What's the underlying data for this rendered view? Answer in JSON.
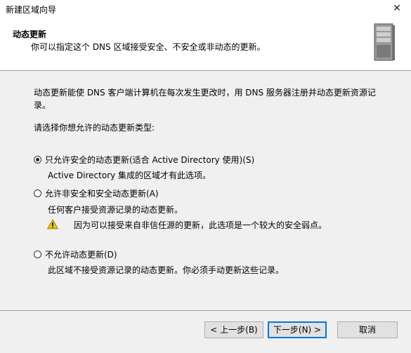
{
  "window": {
    "title": "新建区域向导",
    "close_glyph": "✕"
  },
  "header": {
    "title": "动态更新",
    "subtitle": "你可以指定这个 DNS 区域接受安全、不安全或非动态的更新。",
    "icon": "server-icon"
  },
  "content": {
    "description_line1": "动态更新能使 DNS 客户端计算机在每次发生更改时，用 DNS 服务器注册并动态更新资源记",
    "description_line2": "录。",
    "prompt": "请选择你想允许的动态更新类型:",
    "options": [
      {
        "label": "只允许安全的动态更新(适合 Active Directory 使用)(S)",
        "description": "Active Directory 集成的区域才有此选项。",
        "checked": true
      },
      {
        "label": "允许非安全和安全动态更新(A)",
        "description": "任何客户接受资源记录的动态更新。",
        "checked": false
      },
      {
        "label": "不允许动态更新(D)",
        "description": "此区域不接受资源记录的动态更新。你必须手动更新这些记录。",
        "checked": false
      }
    ],
    "warning": {
      "icon": "warning-icon",
      "text": "因为可以接受来自非信任源的更新，此选项是一个较大的安全弱点。"
    }
  },
  "buttons": {
    "back": "< 上一步(B)",
    "next": "下一步(N) >",
    "cancel": "取消"
  }
}
